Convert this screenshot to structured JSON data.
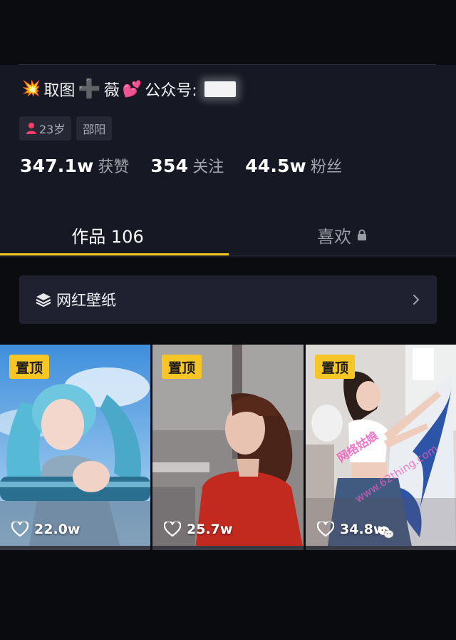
{
  "profile": {
    "bio": {
      "emoji_left": "💥",
      "part1": "取图",
      "plus": "➕",
      "part2": "薇",
      "heart": "💕",
      "part3": "公众号:"
    },
    "tags": [
      {
        "icon": "person-icon",
        "label": "23岁"
      },
      {
        "label": "邵阳"
      }
    ],
    "stats": [
      {
        "value": "347.1w",
        "label": "获赞"
      },
      {
        "value": "354",
        "label": "关注"
      },
      {
        "value": "44.5w",
        "label": "粉丝"
      }
    ]
  },
  "tabs": {
    "works": "作品 106",
    "likes": "喜欢",
    "likes_icon": "lock-icon",
    "active_color": "#f7c81e"
  },
  "collection": {
    "title": "网红壁纸",
    "icon": "stack-icon",
    "chevron": "chevron-right-icon"
  },
  "videos": [
    {
      "pin": "置顶",
      "likes": "22.0w"
    },
    {
      "pin": "置顶",
      "likes": "25.7w"
    },
    {
      "pin": "置顶",
      "likes": "34.8w",
      "watermark": "网络姑娘",
      "watermark_url": "www.62thing.com"
    }
  ],
  "colors": {
    "background": "#0b0c10",
    "profile_bg": "#161824",
    "pin_bg": "#f8c624",
    "accent": "#f7c81e"
  }
}
